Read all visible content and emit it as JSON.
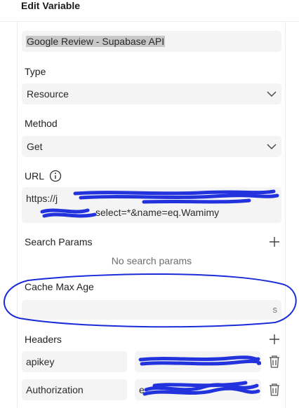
{
  "panel": {
    "title": "Edit Variable"
  },
  "name_field": {
    "value": "Google Review - Supabase API"
  },
  "type": {
    "label": "Type",
    "selected": "Resource"
  },
  "method": {
    "label": "Method",
    "selected": "Get"
  },
  "url": {
    "label": "URL",
    "value_visible_end": "select=*&name=eq.Wamimy",
    "value_visible_start": "https://j"
  },
  "search_params": {
    "label": "Search Params",
    "empty_text": "No search params"
  },
  "cache": {
    "label": "Cache Max Age",
    "suffix": "s",
    "value": ""
  },
  "headers": {
    "label": "Headers",
    "rows": [
      {
        "key": "apikey",
        "value_prefix": ""
      },
      {
        "key": "Authorization",
        "value_prefix": "e"
      }
    ]
  },
  "colors": {
    "annotation": "#1a2bd8",
    "field_bg": "#f4f4f4",
    "redaction": "#2233dd"
  }
}
